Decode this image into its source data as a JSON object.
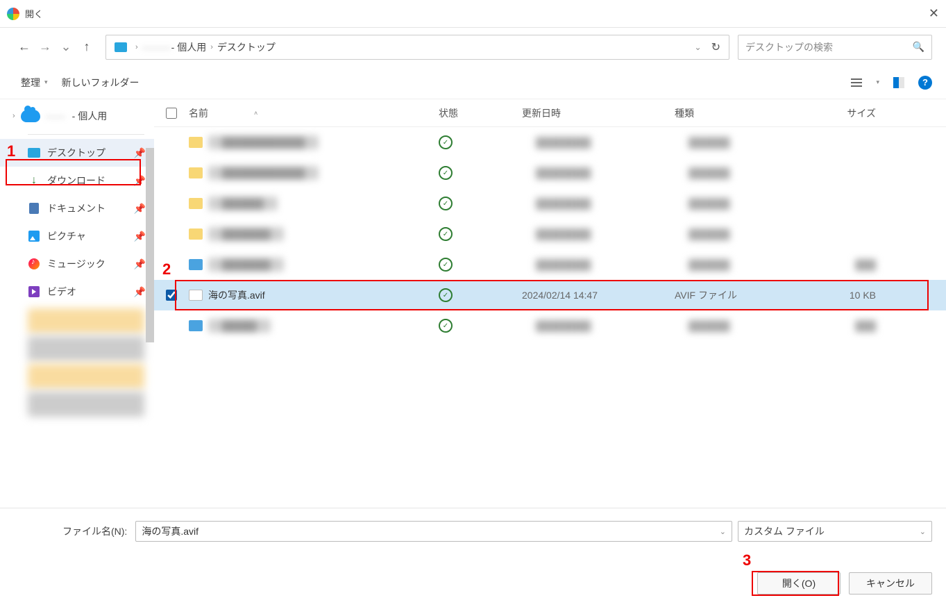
{
  "window": {
    "title": "開く"
  },
  "breadcrumb": {
    "blurred": "———",
    "part1": "- 個人用",
    "part2": "デスクトップ"
  },
  "search": {
    "placeholder": "デスクトップの検索"
  },
  "toolbar": {
    "organize": "整理",
    "newfolder": "新しいフォルダー"
  },
  "sidebar_top": {
    "blurred": "——",
    "label": "- 個人用"
  },
  "sidebar": {
    "items": [
      {
        "label": "デスクトップ",
        "icon": "desktop",
        "pinned": true,
        "selected": true
      },
      {
        "label": "ダウンロード",
        "icon": "download",
        "pinned": true
      },
      {
        "label": "ドキュメント",
        "icon": "doc",
        "pinned": true
      },
      {
        "label": "ピクチャ",
        "icon": "pic",
        "pinned": true
      },
      {
        "label": "ミュージック",
        "icon": "music",
        "pinned": true
      },
      {
        "label": "ビデオ",
        "icon": "video",
        "pinned": true
      }
    ]
  },
  "columns": {
    "name": "名前",
    "state": "状態",
    "date": "更新日時",
    "type": "種類",
    "size": "サイズ"
  },
  "files": {
    "selected": {
      "name": "海の写真.avif",
      "date": "2024/02/14 14:47",
      "type": "AVIF ファイル",
      "size": "10 KB"
    }
  },
  "bottom": {
    "filename_label": "ファイル名(N):",
    "filename_value": "海の写真.avif",
    "filetype_value": "カスタム ファイル",
    "open": "開く(O)",
    "cancel": "キャンセル"
  },
  "annotations": {
    "n1": "1",
    "n2": "2",
    "n3": "3"
  }
}
